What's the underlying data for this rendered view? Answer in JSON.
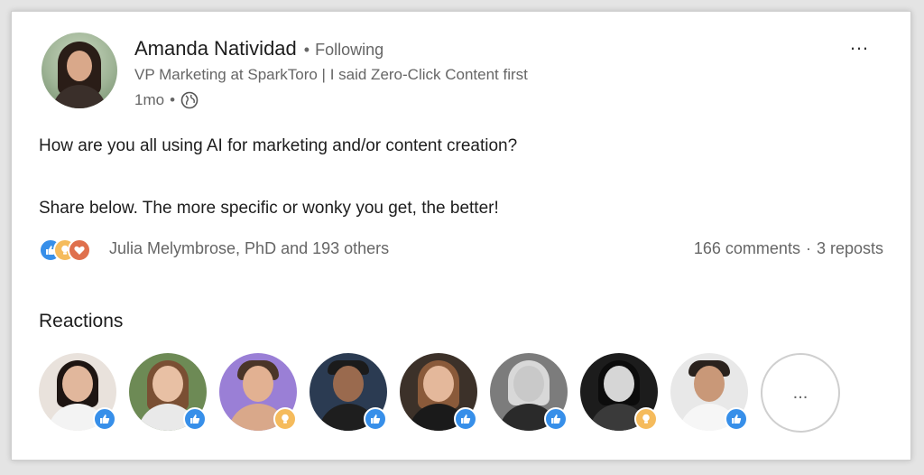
{
  "post": {
    "author_name": "Amanda Natividad",
    "separator": "•",
    "following_label": "Following",
    "headline": "VP Marketing at SparkToro | I said Zero-Click Content first",
    "time_ago": "1mo",
    "visibility_icon": "globe-icon",
    "more_label": "…",
    "text_line_1": "How are you all using AI for marketing and/or content creation?",
    "text_line_2": "Share below. The more specific or wonky you get, the better!"
  },
  "social": {
    "reaction_types": [
      "like-icon",
      "insightful-icon",
      "love-icon"
    ],
    "reactors_summary": "Julia Melymbrose, PhD and 193 others",
    "comments": "166 comments",
    "separator": "·",
    "reposts": "3 reposts"
  },
  "reactions": {
    "heading": "Reactions",
    "people": [
      {
        "name": "reactor-1",
        "reaction": "like"
      },
      {
        "name": "reactor-2",
        "reaction": "like"
      },
      {
        "name": "reactor-3",
        "reaction": "insightful"
      },
      {
        "name": "reactor-4",
        "reaction": "like"
      },
      {
        "name": "reactor-5",
        "reaction": "like"
      },
      {
        "name": "reactor-6",
        "reaction": "like"
      },
      {
        "name": "reactor-7",
        "reaction": "insightful"
      },
      {
        "name": "reactor-8",
        "reaction": "like"
      }
    ],
    "more_label": "..."
  },
  "colors": {
    "like": "#378fe9",
    "insightful": "#f5bb5c",
    "love": "#df704d",
    "text_primary": "#1d1d1d",
    "text_secondary": "#666666"
  }
}
